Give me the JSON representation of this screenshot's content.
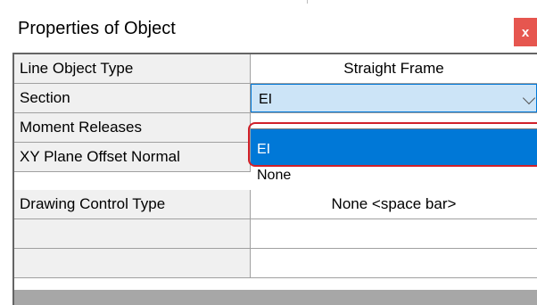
{
  "window": {
    "title": "Properties of Object",
    "close_label": "x"
  },
  "rows": [
    {
      "label": "Line Object Type",
      "value": "Straight Frame"
    },
    {
      "label": "Section",
      "value": "EI"
    },
    {
      "label": "Moment Releases",
      "value": ""
    },
    {
      "label": "XY Plane Offset Normal",
      "value": ""
    },
    {
      "label": "Drawing Control Type",
      "value": "None  <space bar>"
    },
    {
      "label": "",
      "value": ""
    },
    {
      "label": "",
      "value": ""
    }
  ],
  "dropdown": {
    "selected": "EI",
    "options": [
      "EI",
      "None"
    ]
  },
  "colors": {
    "selection": "#0078d7",
    "combo_fill": "#cce4f7",
    "highlight": "#d0202a",
    "close": "#e6564f"
  },
  "icons": {
    "combo_arrow": "chevron-down-icon",
    "close": "close-icon"
  }
}
